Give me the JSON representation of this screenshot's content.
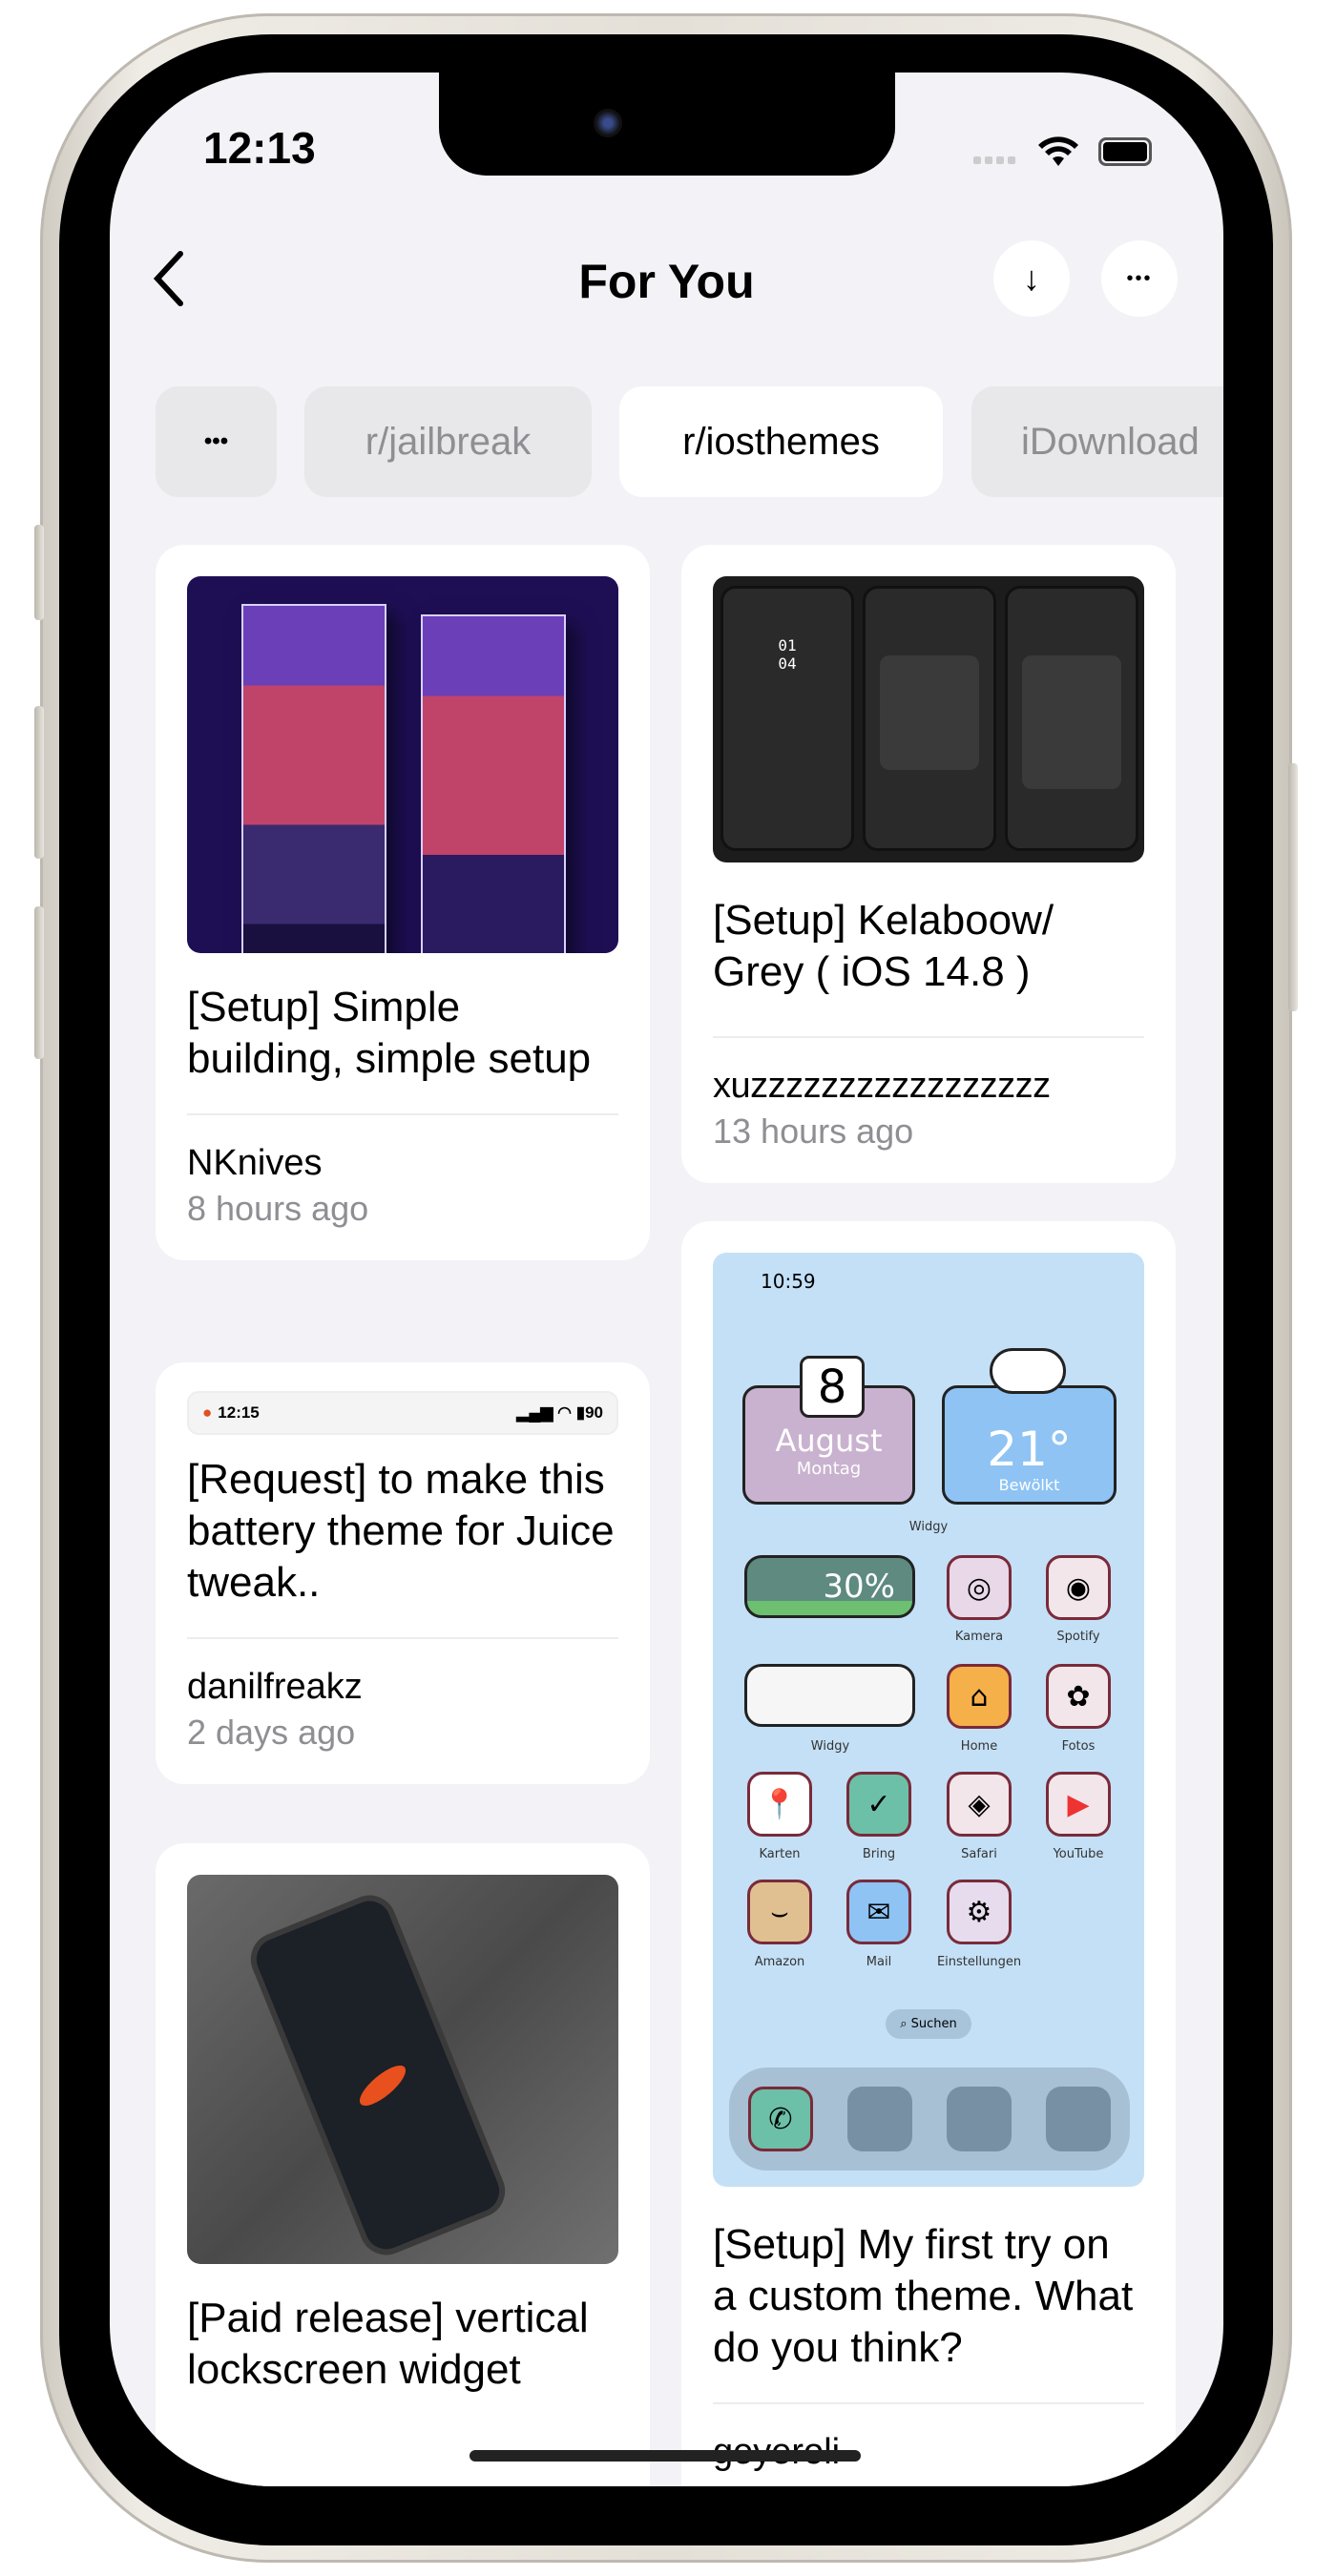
{
  "status_bar": {
    "time": "12:13"
  },
  "nav": {
    "title": "For You",
    "back_icon": "chevron-left-icon",
    "download_icon": "arrow-down-icon",
    "more_icon": "ellipsis-icon",
    "download_glyph": "↓",
    "more_glyph": "•••"
  },
  "tabs": [
    {
      "label": "•••"
    },
    {
      "label": "r/jailbreak"
    },
    {
      "label": "r/iosthemes",
      "active": true
    },
    {
      "label": "iDownload"
    }
  ],
  "posts": [
    {
      "title": "[Setup] Simple building, simple setup",
      "author": "NKnives",
      "time": "8 hours ago"
    },
    {
      "title": "[Request] to make this battery theme for Juice tweak..",
      "author": "danilfreakz",
      "time": "2 days ago",
      "preview": {
        "time": "12:15",
        "battery": "90"
      }
    },
    {
      "title": "[Paid release] vertical lockscreen widget"
    },
    {
      "title": "[Setup] Kelaboow/ Grey ( iOS 14.8 )",
      "author": "xuzzzzzzzzzzzzzzzzz",
      "time": "13 hours ago",
      "preview": {
        "clock": "01\n04"
      }
    },
    {
      "title": "[Setup] My first try on a custom theme. What do you think?",
      "author": "geyeroli",
      "preview": {
        "time": "10:59",
        "date_day": "8",
        "date_month": "August",
        "date_weekday": "Montag",
        "temp": "21°",
        "weather": "Bewölkt",
        "widget_label": "Widgy",
        "battery": "30%",
        "apps": [
          "Kamera",
          "Spotify",
          "Widgy",
          "Home",
          "Fotos",
          "Karten",
          "Bring",
          "Safari",
          "YouTube",
          "Amazon",
          "Mail",
          "Einstellungen"
        ],
        "search": "Suchen"
      }
    }
  ],
  "colors": {
    "background": "#f2f2f7",
    "card": "#ffffff",
    "secondary_text": "#8e8e93",
    "tab_inactive": "#e8e8ea"
  }
}
